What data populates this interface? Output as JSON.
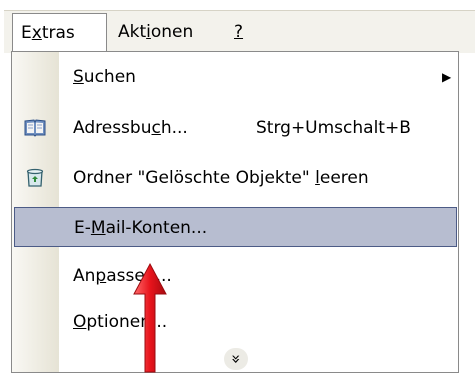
{
  "menubar": {
    "items": [
      {
        "pre": "E",
        "u": "x",
        "post": "tras"
      },
      {
        "pre": "Akt",
        "u": "i",
        "post": "onen"
      },
      {
        "pre": "",
        "u": "?",
        "post": ""
      }
    ]
  },
  "menu": {
    "items": [
      {
        "pre": "",
        "u": "S",
        "post": "uchen",
        "shortcut": "",
        "submenu_arrow": "▶"
      },
      {
        "pre": "Adressbu",
        "u": "c",
        "post": "h...",
        "shortcut": "Strg+Umschalt+B",
        "icon": "address-book-icon"
      },
      {
        "pre": "Ordner \"Gelöschte Objekte\" ",
        "u": "l",
        "post": "eeren",
        "shortcut": "",
        "icon": "recycle-bin-icon"
      },
      {
        "pre": "E-",
        "u": "M",
        "post": "ail-Konten...",
        "shortcut": "",
        "highlighted": true
      },
      {
        "pre": "An",
        "u": "p",
        "post": "assen...",
        "shortcut": ""
      },
      {
        "pre": "",
        "u": "O",
        "post": "ptionen...",
        "shortcut": ""
      }
    ],
    "expand_glyph": "»",
    "colors": {
      "highlight": "#b7bdd0",
      "highlight_border": "#4c5b86",
      "annotation_arrow": "#e8141c"
    }
  }
}
